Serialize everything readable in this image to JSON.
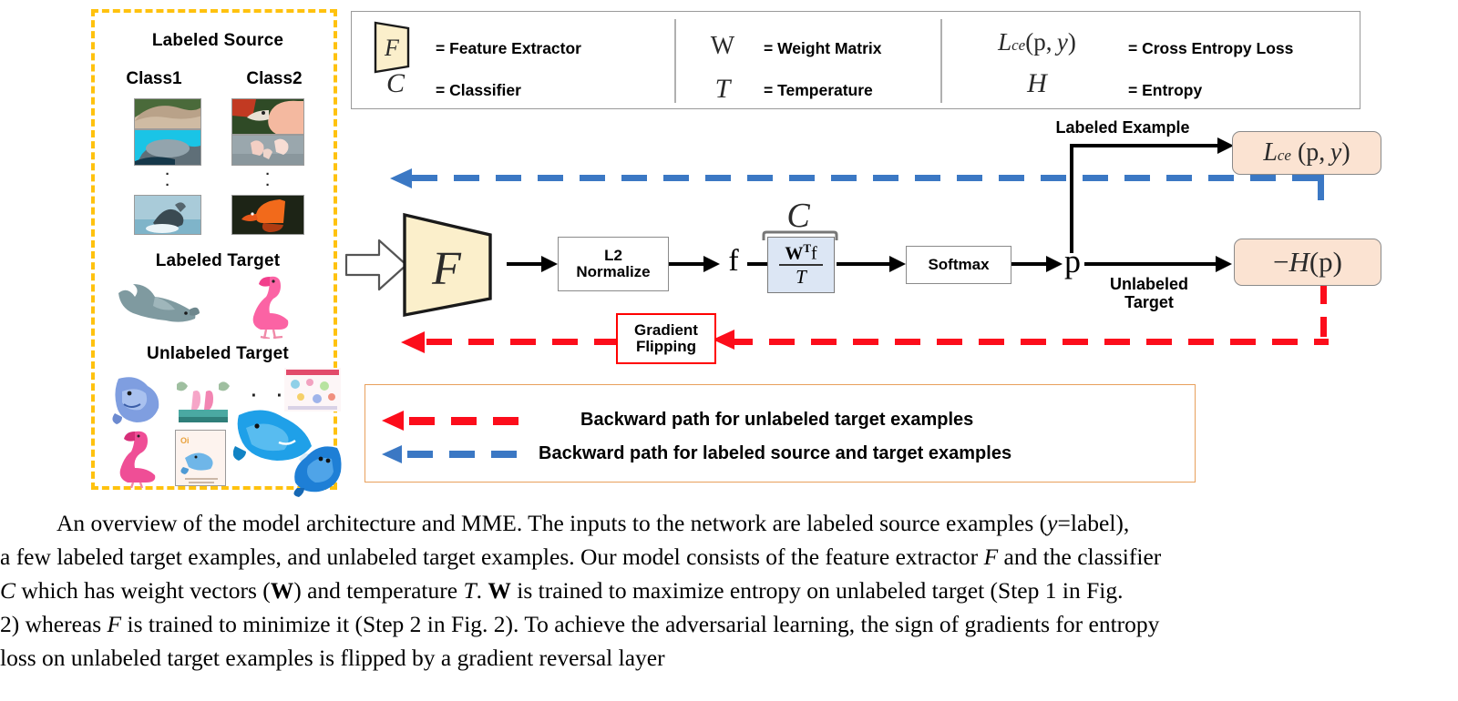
{
  "source_panel": {
    "title": "Labeled Source",
    "class1_label": "Class1",
    "class2_label": "Class2",
    "dots": "·",
    "labeled_target_title": "Labeled Target",
    "unlabeled_target_title": "Unlabeled Target",
    "border_color": "#FFC20E"
  },
  "legend": {
    "items": [
      {
        "symbol": "F",
        "text": "= Feature Extractor"
      },
      {
        "symbol": "C",
        "text": "= Classifier"
      },
      {
        "symbol": "W",
        "text": "= Weight Matrix"
      },
      {
        "symbol": "T",
        "text": "= Temperature"
      },
      {
        "symbol": "Lce(p, y)",
        "text": "= Cross Entropy Loss"
      },
      {
        "symbol": "H",
        "text": "= Entropy"
      }
    ]
  },
  "diagram": {
    "feature_extractor_symbol": "F",
    "l2_normalize_label": "L2\nNormalize",
    "feature_symbol": "f",
    "classifier_symbol": "C",
    "classifier_numerator": "WTf",
    "classifier_denominator": "T",
    "softmax_label": "Softmax",
    "prob_symbol": "p",
    "labeled_example_label": "Labeled Example",
    "unlabeled_target_label": "Unlabeled\nTarget",
    "ce_loss_label": "Lce (p, y)",
    "entropy_label": "−H(p)",
    "gradient_flipping_label": "Gradient\nFlipping",
    "colors": {
      "feature_extractor_fill": "#FBEFCB",
      "classifier_fill": "#dce6f4",
      "loss_fill": "#fbe3d2",
      "red_path": "#fc0d1b",
      "blue_path": "#3b78c4",
      "gradient_flip_border": "#ff0000"
    }
  },
  "path_legend": {
    "border_color": "#E8A05C",
    "rows": [
      {
        "color": "#fc0d1b",
        "text": "Backward path for unlabeled target examples"
      },
      {
        "color": "#3b78c4",
        "text": "Backward path for labeled source and target examples"
      }
    ]
  },
  "caption": {
    "line1_a": "An overview of the model architecture and MME. The inputs to the network are labeled source examples (",
    "line1_y": "y",
    "line1_b": "=label),",
    "line2_a": "a few labeled target examples, and unlabeled target examples. Our model consists of the feature extractor ",
    "line2_F": "F",
    "line2_b": " and the classifier",
    "line3_C": "C",
    "line3_a": " which has weight vectors (",
    "line3_W": "W",
    "line3_b": ") and temperature ",
    "line3_T": "T",
    "line3_c": ". ",
    "line3_W2": "W",
    "line3_d": " is trained to maximize entropy on unlabeled target (Step 1 in Fig.",
    "line4_a": "2) whereas ",
    "line4_F": "F",
    "line4_b": " is trained to minimize it (Step 2 in Fig.  2). To achieve the adversarial learning, the sign of gradients for entropy",
    "line5": "loss on unlabeled target examples is flipped by a gradient reversal layer"
  }
}
